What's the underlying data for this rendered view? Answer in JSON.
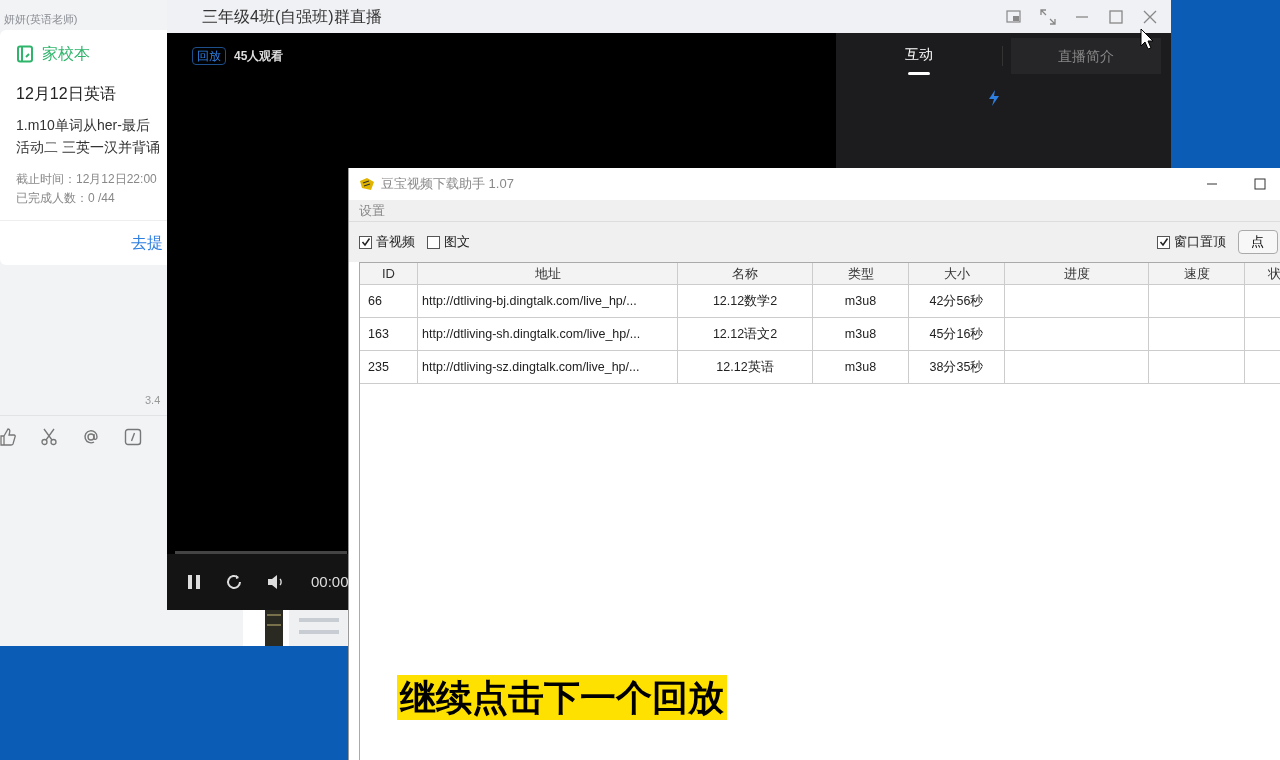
{
  "chat_window": {
    "sender": "妍妍(英语老师)",
    "card": {
      "app_name": "家校本",
      "title": "12月12日英语",
      "body_lines": [
        "1.m10单词从her-最后",
        "活动二 三英一汉并背诵"
      ],
      "deadline": "截止时间：12月12日22:00",
      "completed": "已完成人数：0 /44",
      "action": "去提"
    },
    "meta": "3.4"
  },
  "live_window": {
    "title": "三年级4班(自强班)群直播",
    "badge": "回放",
    "viewers": "45人观看",
    "tabs": [
      {
        "label": "互动",
        "selected": true
      },
      {
        "label": "直播简介",
        "selected": false
      }
    ],
    "time": "00:00"
  },
  "downloader": {
    "title": "豆宝视频下载助手 1.07",
    "menu": [
      "设置"
    ],
    "options": [
      {
        "label": "音视频",
        "checked": true
      },
      {
        "label": "图文",
        "checked": false
      }
    ],
    "pin": {
      "label": "窗口置顶",
      "checked": true
    },
    "button": "点",
    "table": {
      "columns": [
        "ID",
        "地址",
        "名称",
        "类型",
        "大小",
        "进度",
        "速度",
        "状"
      ],
      "rows": [
        {
          "id": "66",
          "url": "http://dtliving-bj.dingtalk.com/live_hp/...",
          "name": "12.12数学2",
          "type": "m3u8",
          "size": "42分56秒"
        },
        {
          "id": "163",
          "url": "http://dtliving-sh.dingtalk.com/live_hp/...",
          "name": "12.12语文2",
          "type": "m3u8",
          "size": "45分16秒"
        },
        {
          "id": "235",
          "url": "http://dtliving-sz.dingtalk.com/live_hp/...",
          "name": "12.12英语",
          "type": "m3u8",
          "size": "38分35秒"
        }
      ]
    }
  },
  "caption": "继续点击下一个回放"
}
